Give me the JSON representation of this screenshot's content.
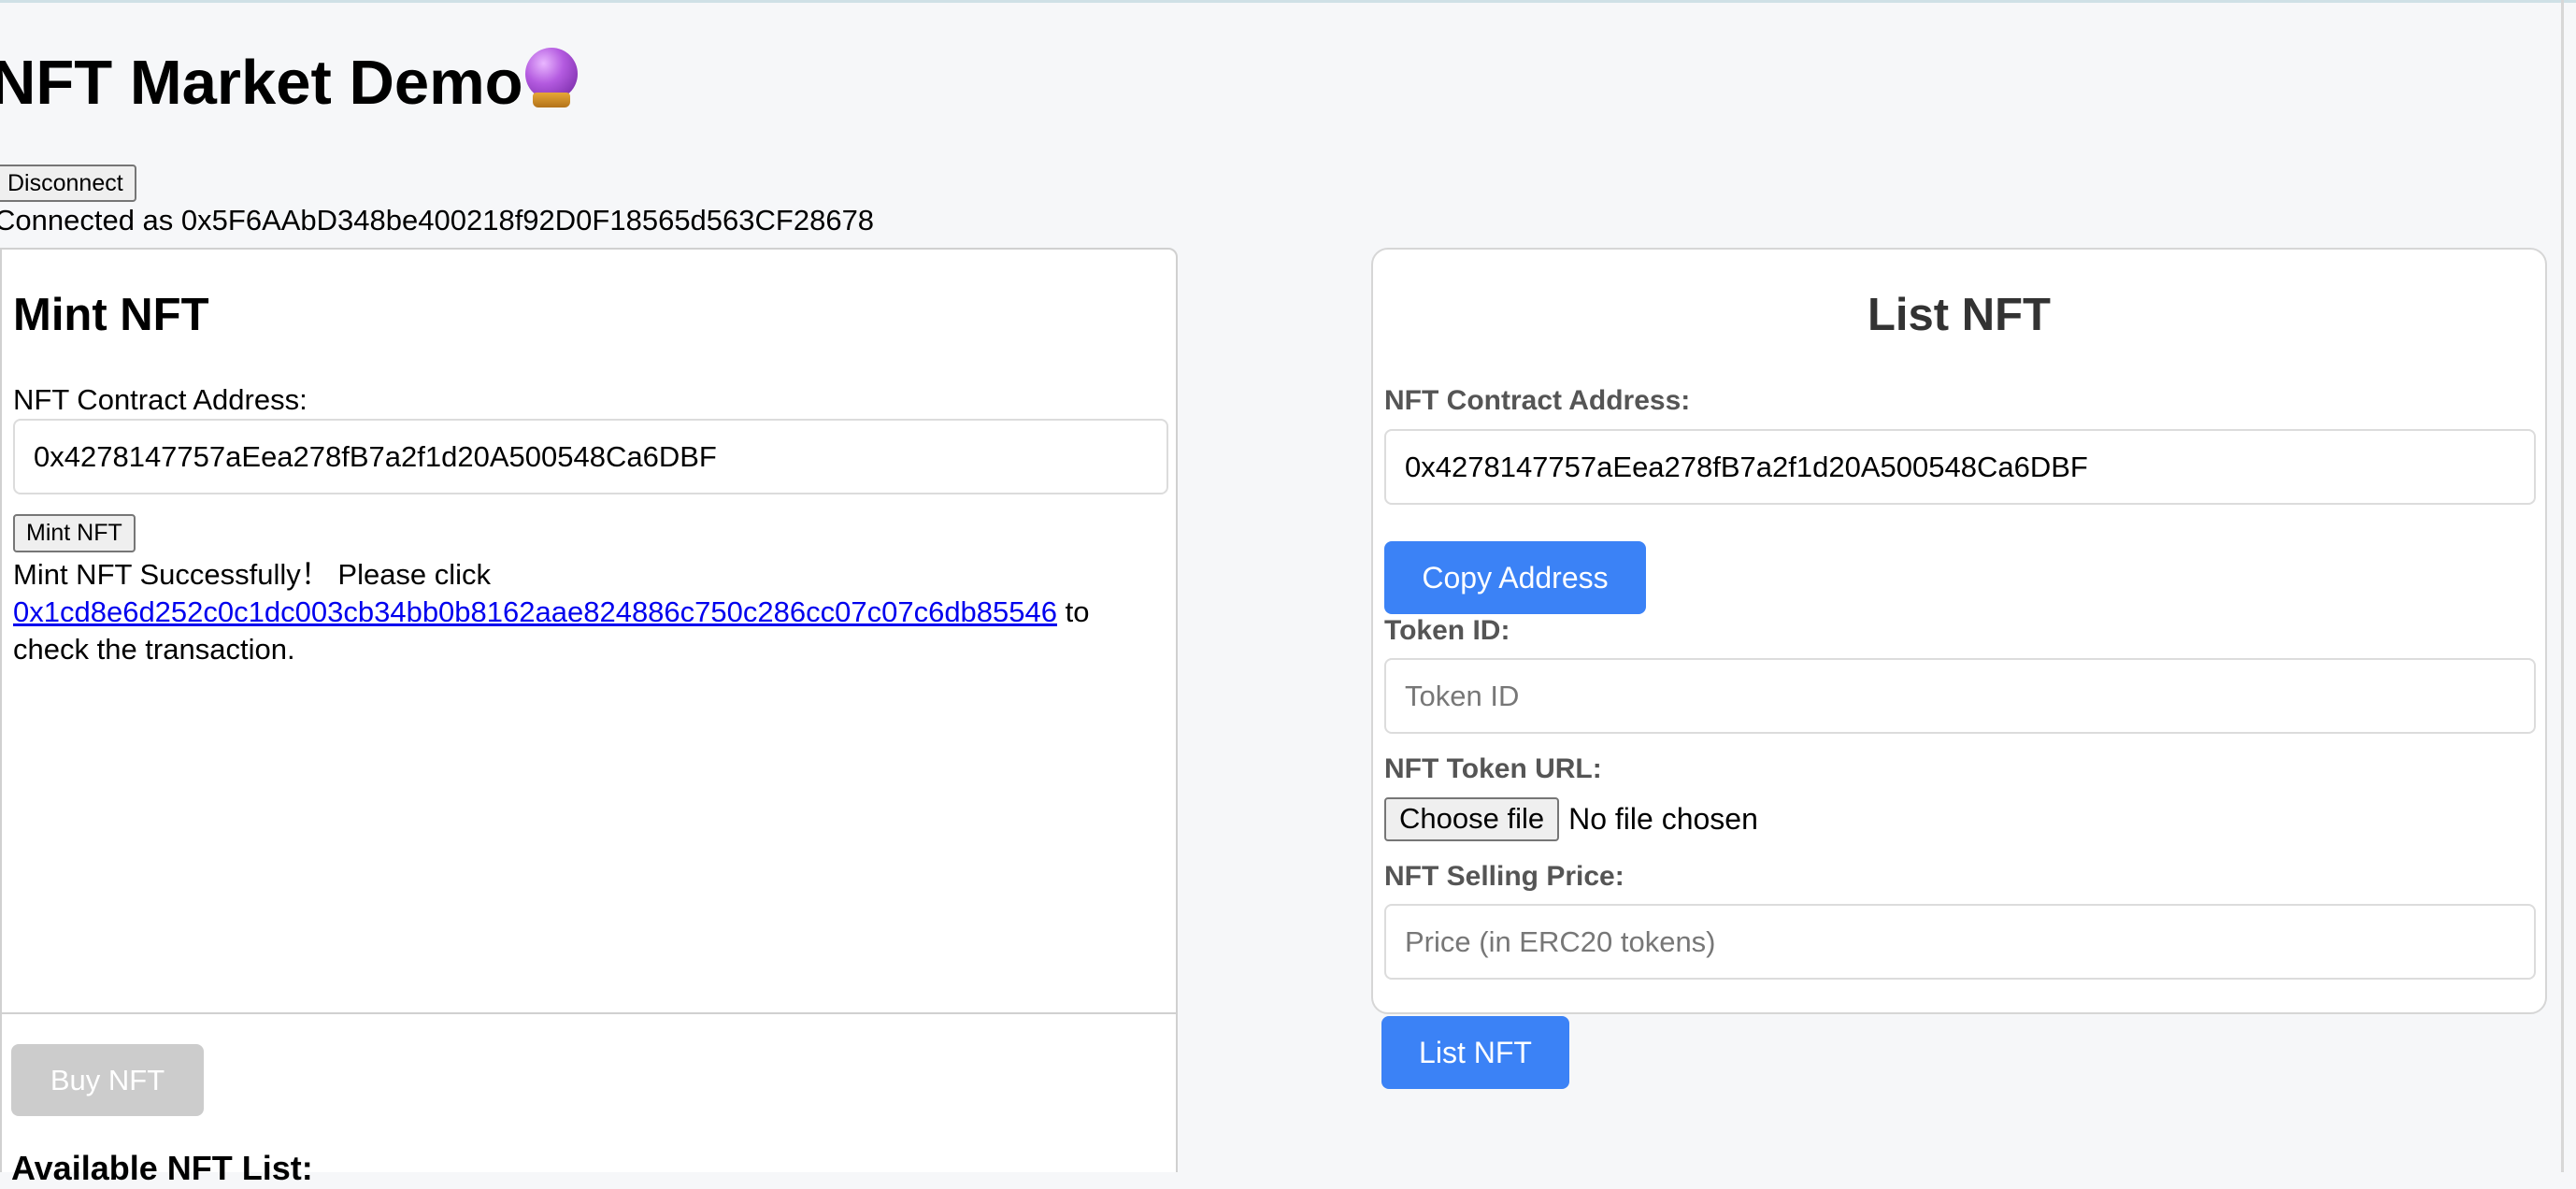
{
  "header": {
    "title": "NFT Market Demo",
    "title_emoji_icon": "crystal-ball-icon",
    "disconnect_label": "Disconnect",
    "connected_text": "Connected as 0x5F6AAbD348be400218f92D0F18565d563CF28678"
  },
  "mint": {
    "title": "Mint NFT",
    "contract_label": "NFT Contract Address:",
    "contract_value": "0x4278147757aEea278fB7a2f1d20A500548Ca6DBF",
    "mint_button": "Mint NFT",
    "success_prefix": "Mint NFT Successfully！  Please click",
    "tx_hash": "0x1cd8e6d252c0c1dc003cb34bb0b8162aae824886c750c286cc07c07c6db85546",
    "success_suffix": "to check the transaction."
  },
  "buy": {
    "buy_button": "Buy NFT",
    "available_title": "Available NFT List:"
  },
  "list": {
    "title": "List NFT",
    "contract_label": "NFT Contract Address:",
    "contract_value": "0x4278147757aEea278fB7a2f1d20A500548Ca6DBF",
    "copy_button": "Copy Address",
    "token_id_label": "Token ID:",
    "token_id_placeholder": "Token ID",
    "token_url_label": "NFT Token URL:",
    "choose_file": "Choose file",
    "no_file": "No file chosen",
    "price_label": "NFT Selling Price:",
    "price_placeholder": "Price (in ERC20 tokens)",
    "list_button": "List NFT"
  },
  "colors": {
    "primary": "#3b82f6",
    "disabled": "#cccccc",
    "link": "#0000ee"
  }
}
